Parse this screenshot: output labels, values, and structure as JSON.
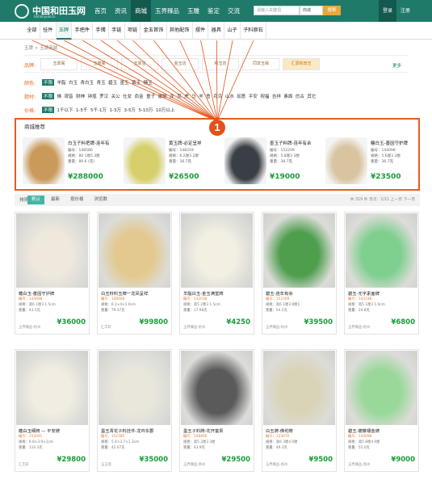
{
  "header": {
    "logo_text": "中国和田玉网",
    "logo_sub": "hetianyuw.cn",
    "nav": [
      "首页",
      "资讯",
      "商城",
      "玉界臻品",
      "玉雕",
      "鉴定",
      "交流"
    ],
    "nav_active_index": 2,
    "search_placeholder": "请输入关键词",
    "search_scope": "商城",
    "search_button": "搜索",
    "login": "登录",
    "register": "注册"
  },
  "categories": {
    "items": [
      "全部",
      "挂件",
      "玉牌",
      "手把件",
      "手镯",
      "手链",
      "项链",
      "金玉首饰",
      "其他配饰",
      "摆件",
      "器具",
      "山子",
      "子料原石"
    ],
    "selected_index": 2
  },
  "breadcrumb": "玉牌 > 玉牌商城",
  "filters": {
    "brand_label": "品牌:",
    "brands": [
      "玉翠阁",
      "玉隆阁",
      "玉翠宝",
      "金玉坊",
      "和玉坊",
      "同享玉缘",
      "汇源和田玉"
    ],
    "brand_highlight_index": 6,
    "more": "更多",
    "color_label": "颜色:",
    "colors": [
      "不限",
      "羊脂",
      "白玉",
      "青白玉",
      "青玉",
      "碧玉",
      "墨玉",
      "黄玉",
      "糖玉"
    ],
    "theme_label": "题材:",
    "themes": [
      "不限",
      "佛",
      "观音",
      "财神",
      "钟馗",
      "罗汉",
      "关公",
      "仕女",
      "俞金",
      "童子",
      "貔貅",
      "龙",
      "凤",
      "虎",
      "马",
      "羊",
      "鱼",
      "花鸟",
      "山水",
      "如意",
      "平安",
      "祝福",
      "吉祥",
      "素面",
      "仿古",
      "其它"
    ],
    "price_label": "价格:",
    "prices": [
      "不限",
      "1千以下",
      "1-5千",
      "5千-1万",
      "1-3万",
      "3-5万",
      "5-10万",
      "10万以上"
    ]
  },
  "recommend": {
    "title": "商城推荐",
    "items": [
      {
        "name": "白玉子料把牌-连年有",
        "code": "编号：148586",
        "spec": "规格：80 1厘5 3厘",
        "weight": "重量：80.6 (克)",
        "price": "¥288000",
        "color": "#c99a5a"
      },
      {
        "name": "黄玉牌-必定呈祥",
        "code": "编号：148319",
        "spec": "规格：6.2厘3 2厘",
        "weight": "重量：36.7克",
        "price": "¥26500",
        "color": "#d6cf6a"
      },
      {
        "name": "墨玉子料牌-连年有余",
        "code": "编号：152209",
        "spec": "规格：5.8厘3 3厘",
        "weight": "重量：38.7克",
        "price": "¥19000",
        "color": "#3a3f45"
      },
      {
        "name": "糖白玉-善因守护牌",
        "code": "编号：144098",
        "spec": "规格：5.6厘3 3厘",
        "weight": "重量：36.7克",
        "price": "¥23500",
        "color": "#d8c4a0"
      }
    ]
  },
  "sortbar": {
    "label": "排序:",
    "options": [
      "默认",
      "最新",
      "按价格",
      "浏览数"
    ],
    "selected_index": 0,
    "pager": "共 319 件  页次：1/11  上一页  下一页"
  },
  "products": [
    {
      "name": "糖白玉-善因守护牌",
      "code": "编号：144098",
      "spec": "规格：高6 1厘3 1.5cm",
      "weight": "重量：43.5克",
      "price": "¥36000",
      "shop": "玉界臻品-杭州",
      "color": "#efe9dd"
    },
    {
      "name": "白玉籽料玉牌一龙凤呈祥",
      "code": "编号：148468",
      "spec": "规格：6.1×4×1.0cm",
      "weight": "重量：79.37克",
      "price": "¥99800",
      "shop": "汇丰轩",
      "color": "#e3c98f"
    },
    {
      "name": "羊脂白玉-金玉满堂牌",
      "code": "编号：132038",
      "spec": "规格：高5 2厘3 1.5cm",
      "weight": "重量：17.98克",
      "price": "¥4250",
      "shop": "玉界臻品-杭州",
      "color": "#f3efe3"
    },
    {
      "name": "碧玉-连年有余",
      "code": "编号：152309",
      "spec": "规格：高6 1厘3 8厘1",
      "weight": "重量：54.2克",
      "price": "¥39500",
      "shop": "玉界臻品-杭州",
      "color": "#4e9e4e"
    },
    {
      "name": "碧玉-无字素面牌",
      "code": "编号：144198",
      "spec": "规格：高5 1厘3 1.0cm",
      "weight": "重量：24.8克",
      "price": "¥6800",
      "shop": "玉界臻品-杭州",
      "color": "#7fcf8f"
    },
    {
      "name": "糖白玉细牌 — 平安牌",
      "code": "编号：152041",
      "spec": "规格：6.8×3.9×1cm",
      "weight": "重量：110.3克",
      "price": "¥29800",
      "shop": "汇丰轩",
      "color": "#f1ede2"
    },
    {
      "name": "墨玉青花子料挂件-龙吟东郡",
      "code": "编号：152385",
      "spec": "规格：5.4×3.7×1.3cm",
      "weight": "重量：42.07克",
      "price": "¥35000",
      "shop": "玉玉斋",
      "color": "#e9e6dc"
    },
    {
      "name": "墨玉子料牌-花开富贵",
      "code": "编号：148466",
      "spec": "规格：高5 2厘3 3厘",
      "weight": "重量：43.9克",
      "price": "¥29500",
      "shop": "玉界臻品-扬州",
      "color": "#5a5a5a"
    },
    {
      "name": "白玉牌-佛坨牌",
      "code": "编号：123070",
      "spec": "规格：高6 3厘4 0厘",
      "weight": "重量：49.3克",
      "price": "¥9500",
      "shop": "玉界臻品-扬州",
      "color": "#d9d4b8"
    },
    {
      "name": "碧玉-貔貅镶金牌",
      "code": "编号：144098",
      "spec": "规格：高5 8厘4 0厘",
      "weight": "重量：55.0克",
      "price": "¥9000",
      "shop": "玉界臻品-扬州",
      "color": "#9ad89a"
    }
  ],
  "annotation": {
    "number": "1",
    "color": "#e2521a"
  }
}
